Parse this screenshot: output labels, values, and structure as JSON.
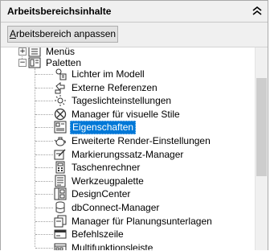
{
  "header": {
    "title": "Arbeitsbereichsinhalte"
  },
  "toolbar": {
    "customize_label": "Arbeitsbereich anpassen",
    "customize_accesskey": "A"
  },
  "tree": {
    "top_nodes": [
      {
        "label": "Menüs",
        "icon": "menu-icon",
        "expanded": false
      },
      {
        "label": "Paletten",
        "icon": "palette-icon",
        "expanded": true
      }
    ],
    "palettes": [
      {
        "label": "Lichter im Modell",
        "icon": "lights-icon"
      },
      {
        "label": "Externe Referenzen",
        "icon": "xref-icon"
      },
      {
        "label": "Tageslichteinstellungen",
        "icon": "sun-icon"
      },
      {
        "label": "Manager für visuelle Stile",
        "icon": "visual-styles-icon"
      },
      {
        "label": "Eigenschaften",
        "icon": "properties-icon",
        "selected": true
      },
      {
        "label": "Erweiterte Render-Einstellungen",
        "icon": "teapot-icon"
      },
      {
        "label": "Markierungssatz-Manager",
        "icon": "markup-icon"
      },
      {
        "label": "Taschenrechner",
        "icon": "calculator-icon"
      },
      {
        "label": "Werkzeugpalette",
        "icon": "tool-palette-icon"
      },
      {
        "label": "DesignCenter",
        "icon": "designcenter-icon"
      },
      {
        "label": "dbConnect-Manager",
        "icon": "dbconnect-icon"
      },
      {
        "label": "Manager für Planungsunterlagen",
        "icon": "sheet-set-icon"
      },
      {
        "label": "Befehlszeile",
        "icon": "command-line-icon"
      },
      {
        "label": "Multifunktionsleiste",
        "icon": "ribbon-icon"
      }
    ]
  },
  "colors": {
    "selection": "#0078d7",
    "panel_bg": "#f0f0f0",
    "scroll_thumb": "#cdcdcd"
  }
}
